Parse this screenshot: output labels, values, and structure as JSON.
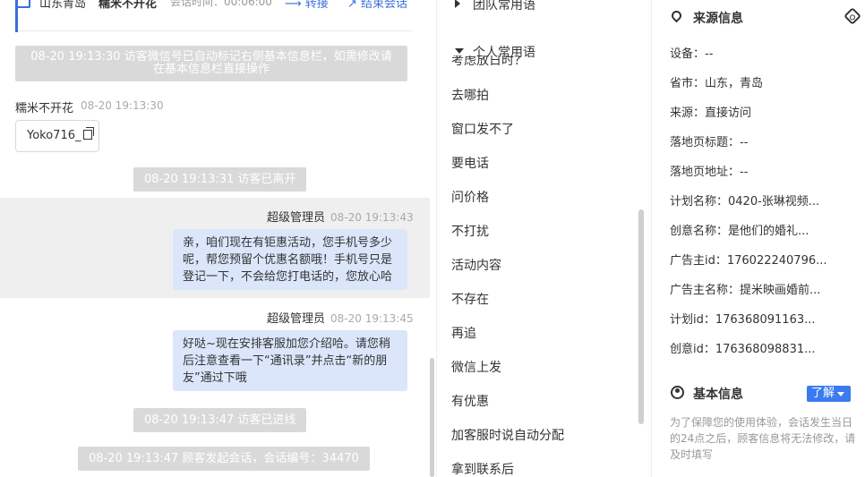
{
  "chat": {
    "header": {
      "location": "山东青岛",
      "visitor_name": "糯米不开花",
      "duration_label": "会话时间：00:06:00",
      "transfer_label": "⟶ 转接",
      "end_label": "↗ 结束会话"
    },
    "system_note": "08-20 19:13:30 访客微信号已自动标记右侧基本信息栏，如需修改请在基本信息栏直接操作",
    "visitor_msg": {
      "name": "糯米不开花",
      "time": "08-20 19:13:30",
      "chip_text": "Yoko716_"
    },
    "sys_left": "08-20 19:13:31 访客已离开",
    "agent_msg1": {
      "name": "超级管理员",
      "time": "08-20 19:13:43",
      "text": "亲，咱们现在有钜惠活动，您手机号多少呢，帮您预留个优惠名额哦！手机号只是登记一下，不会给您打电话的，您放心哈"
    },
    "agent_msg2": {
      "name": "超级管理员",
      "time": "08-20 19:13:45",
      "text": "好哒~现在安排客服加您介绍哈。请您稍后注意查看一下“通讯录”并点击“新的朋友”通过下哦"
    },
    "sys_entered": "08-20 19:13:47 访客已进线",
    "sys_session": "08-20 19:13:47 顾客发起会话，会话编号：34470"
  },
  "phrases": {
    "team_label": "团队常用语",
    "personal_label": "个人常用语",
    "clipped_item": "考虑放日时？",
    "items": [
      "去哪拍",
      "窗口发不了",
      "要电话",
      "问价格",
      "不打扰",
      "活动内容",
      "不存在",
      "再追",
      "微信上发",
      "有优惠",
      "加客服时说自动分配",
      "拿到联系后"
    ]
  },
  "info": {
    "source_title": "来源信息",
    "rows": [
      "设备：--",
      "省市：山东，青岛",
      "来源：直接访问",
      "落地页标题：--",
      "落地页地址：--",
      "计划名称：0420-张琳视频...",
      "创意名称：是他们的婚礼...",
      "广告主id：176022240796...",
      "广告主名称：提米映画婚前...",
      "计划id：176368091163...",
      "创意id：176368098831..."
    ],
    "basic_title": "基本信息",
    "learn_label": "了解",
    "basic_hint": "为了保障您的使用体验，会话发生当日的24点之后，顾客信息将无法修改，请及时填写"
  }
}
